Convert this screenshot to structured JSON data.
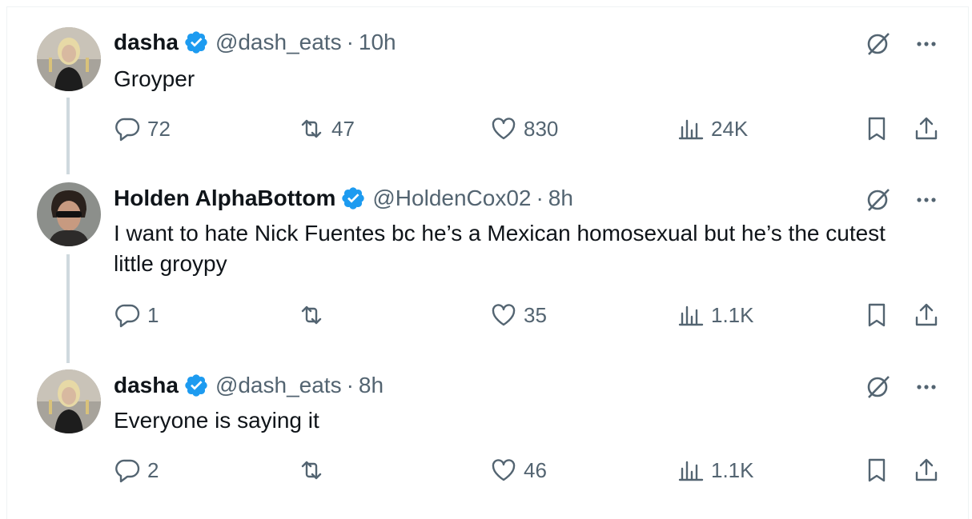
{
  "tweets": [
    {
      "name": "dasha",
      "handle": "@dash_eats",
      "dot": "·",
      "time": "10h",
      "text": "Groyper",
      "replies": "72",
      "retweets": "47",
      "likes": "830",
      "views": "24K"
    },
    {
      "name": "Holden AlphaBottom",
      "handle": "@HoldenCox02",
      "dot": "·",
      "time": "8h",
      "text": "I want to hate Nick Fuentes bc he’s a Mexican homosexual but he’s the cutest little groypy",
      "replies": "1",
      "retweets": "",
      "likes": "35",
      "views": "1.1K"
    },
    {
      "name": "dasha",
      "handle": "@dash_eats",
      "dot": "·",
      "time": "8h",
      "text": "Everyone is saying it",
      "replies": "2",
      "retweets": "",
      "likes": "46",
      "views": "1.1K"
    }
  ],
  "colors": {
    "verified": "#1d9bf0",
    "secondary_text": "#536471",
    "thread_line": "#cfd9de"
  },
  "icons": [
    "reply-icon",
    "retweet-icon",
    "like-icon",
    "views-icon",
    "bookmark-icon",
    "share-icon",
    "grok-icon",
    "more-icon",
    "verified-badge-icon"
  ]
}
